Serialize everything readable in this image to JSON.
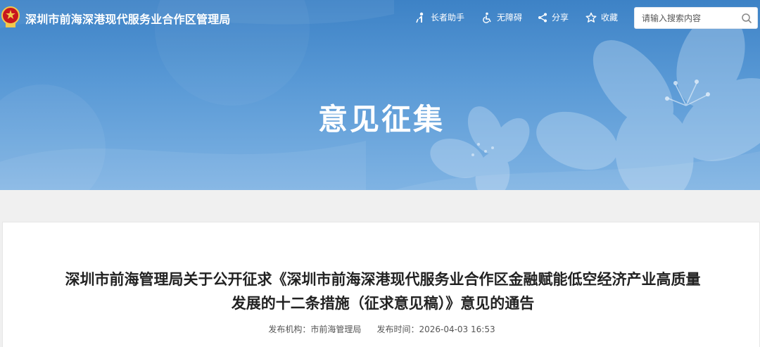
{
  "header": {
    "site_title": "深圳市前海深港现代服务业合作区管理局",
    "tools": {
      "elder_label": "长者助手",
      "access_label": "无障碍",
      "share_label": "分享",
      "favorite_label": "收藏"
    },
    "search": {
      "placeholder": "请输入搜索内容",
      "value": ""
    }
  },
  "hero": {
    "title": "意见征集"
  },
  "article": {
    "title": "深圳市前海管理局关于公开征求《深圳市前海深港现代服务业合作区金融赋能低空经济产业高质量发展的十二条措施（征求意见稿）》意见的通告",
    "publisher_label": "发布机构：",
    "publisher": "市前海管理局",
    "time_label": "发布时间：",
    "time": "2026-04-03 16:53"
  },
  "colors": {
    "hero_top": "#3d82c6",
    "hero_bottom": "#7fb3e3",
    "emblem_red": "#c8161d",
    "emblem_gold": "#f2c94c"
  },
  "icons": [
    "emblem-icon",
    "elder-icon",
    "accessibility-icon",
    "share-icon",
    "star-icon",
    "search-icon"
  ]
}
